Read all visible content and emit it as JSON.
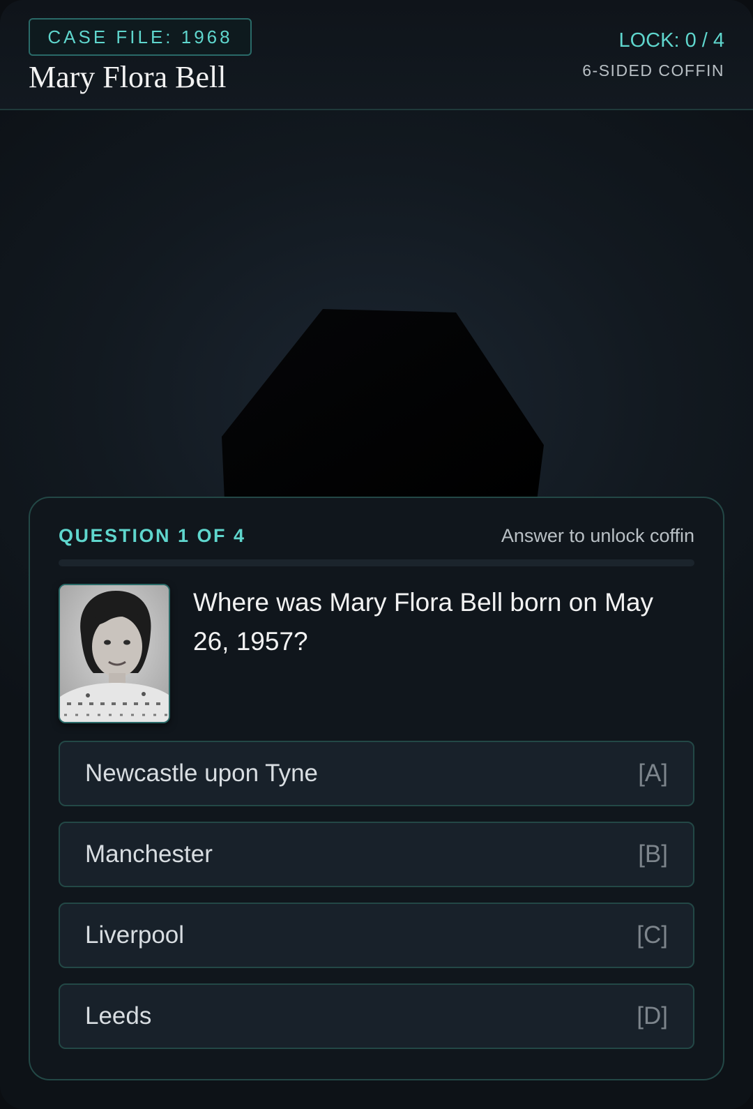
{
  "header": {
    "case_badge": "CASE FILE: 1968",
    "title": "Mary Flora Bell",
    "lock_status": "LOCK: 0 / 4",
    "coffin_type": "6-SIDED COFFIN"
  },
  "coffin": {
    "sides": 6,
    "locked": true
  },
  "question": {
    "counter": "QUESTION 1 OF 4",
    "hint": "Answer to unlock coffin",
    "progress_fraction": 0,
    "text": "Where was Mary Flora Bell born on May 26, 1957?",
    "portrait_icon": "portrait-photo"
  },
  "options": [
    {
      "label": "Newcastle upon Tyne",
      "key": "[A]"
    },
    {
      "label": "Manchester",
      "key": "[B]"
    },
    {
      "label": "Liverpool",
      "key": "[C]"
    },
    {
      "label": "Leeds",
      "key": "[D]"
    }
  ],
  "colors": {
    "accent": "#5fd6cd",
    "border": "#234846",
    "background": "#0d1217",
    "panel": "#10161c",
    "option_bg": "#18212a"
  }
}
